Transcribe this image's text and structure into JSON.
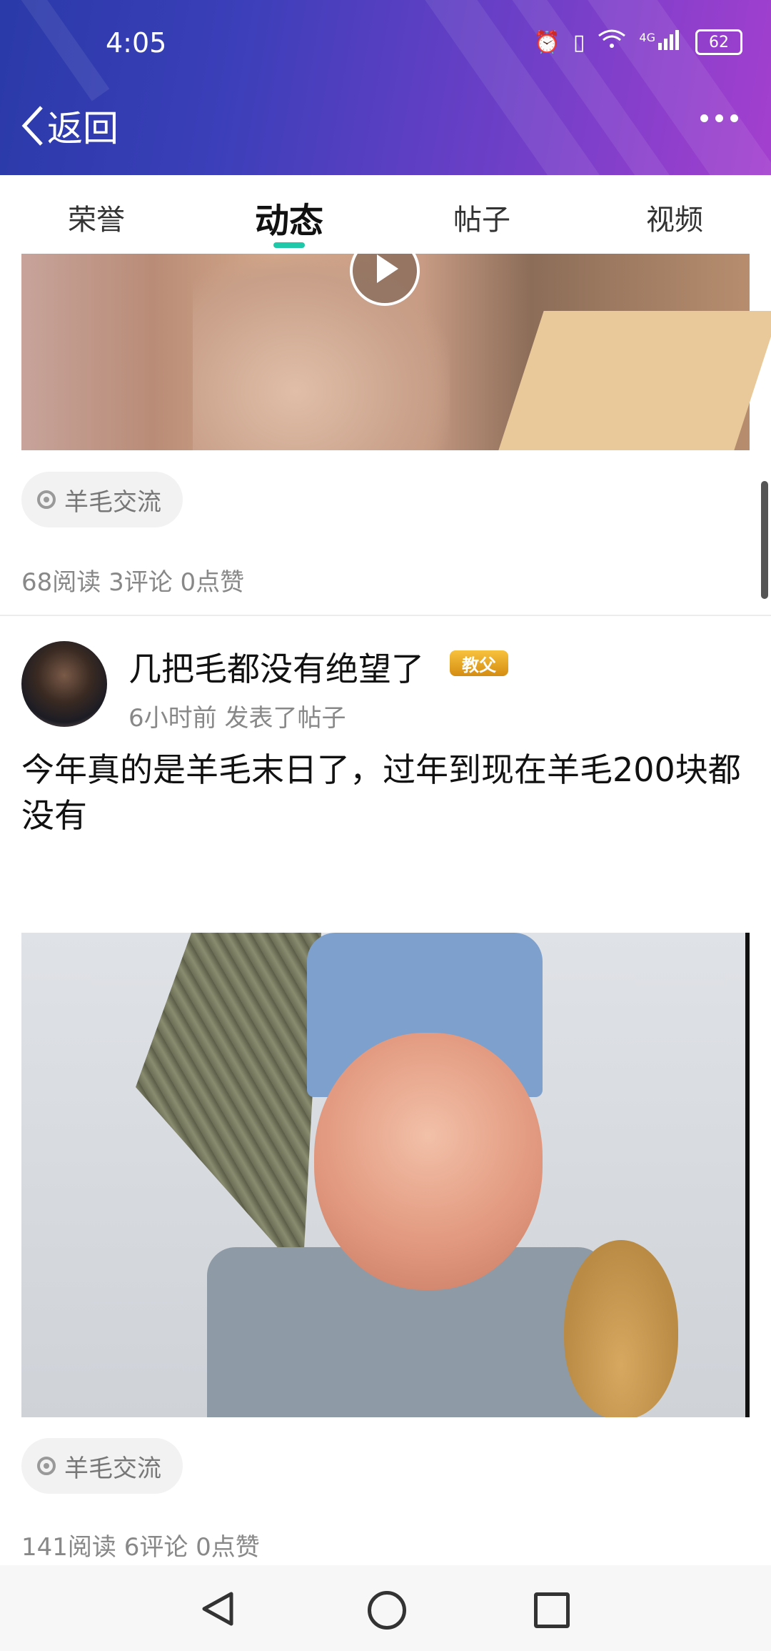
{
  "status_bar": {
    "time": "4:05",
    "network": "4G",
    "battery": "62"
  },
  "header": {
    "back_label": "返回"
  },
  "tabs": [
    {
      "label": "荣誉"
    },
    {
      "label": "动态"
    },
    {
      "label": "帖子"
    },
    {
      "label": "视频"
    }
  ],
  "active_tab": "动态",
  "posts": [
    {
      "tag": "羊毛交流",
      "stats": "68阅读 3评论 0点赞"
    },
    {
      "author": "几把毛都没有绝望了",
      "badge": "教父",
      "meta": "6小时前  发表了帖子",
      "text": "今年真的是羊毛末日了，过年到现在羊毛200块都没有",
      "tag": "羊毛交流",
      "stats": "141阅读 6评论 0点赞"
    }
  ],
  "colors": {
    "accent": "#1ec8a8",
    "header_start": "#2a3aa8",
    "header_end": "#a43fcf"
  }
}
